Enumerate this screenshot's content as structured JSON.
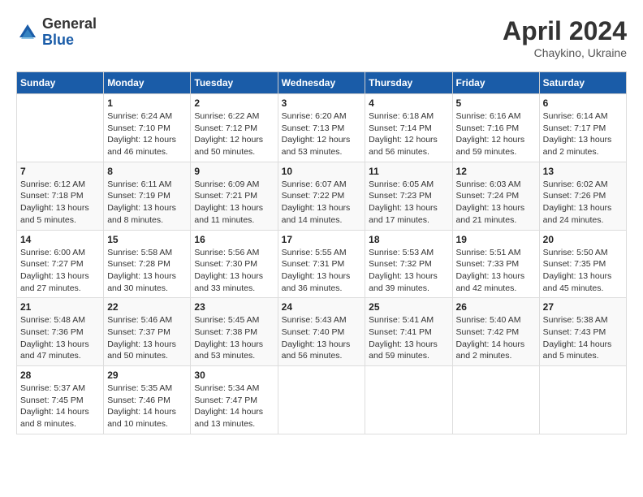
{
  "header": {
    "logo_line1": "General",
    "logo_line2": "Blue",
    "month_title": "April 2024",
    "subtitle": "Chaykino, Ukraine"
  },
  "weekdays": [
    "Sunday",
    "Monday",
    "Tuesday",
    "Wednesday",
    "Thursday",
    "Friday",
    "Saturday"
  ],
  "weeks": [
    [
      {
        "day": "",
        "info": ""
      },
      {
        "day": "1",
        "info": "Sunrise: 6:24 AM\nSunset: 7:10 PM\nDaylight: 12 hours\nand 46 minutes."
      },
      {
        "day": "2",
        "info": "Sunrise: 6:22 AM\nSunset: 7:12 PM\nDaylight: 12 hours\nand 50 minutes."
      },
      {
        "day": "3",
        "info": "Sunrise: 6:20 AM\nSunset: 7:13 PM\nDaylight: 12 hours\nand 53 minutes."
      },
      {
        "day": "4",
        "info": "Sunrise: 6:18 AM\nSunset: 7:14 PM\nDaylight: 12 hours\nand 56 minutes."
      },
      {
        "day": "5",
        "info": "Sunrise: 6:16 AM\nSunset: 7:16 PM\nDaylight: 12 hours\nand 59 minutes."
      },
      {
        "day": "6",
        "info": "Sunrise: 6:14 AM\nSunset: 7:17 PM\nDaylight: 13 hours\nand 2 minutes."
      }
    ],
    [
      {
        "day": "7",
        "info": "Sunrise: 6:12 AM\nSunset: 7:18 PM\nDaylight: 13 hours\nand 5 minutes."
      },
      {
        "day": "8",
        "info": "Sunrise: 6:11 AM\nSunset: 7:19 PM\nDaylight: 13 hours\nand 8 minutes."
      },
      {
        "day": "9",
        "info": "Sunrise: 6:09 AM\nSunset: 7:21 PM\nDaylight: 13 hours\nand 11 minutes."
      },
      {
        "day": "10",
        "info": "Sunrise: 6:07 AM\nSunset: 7:22 PM\nDaylight: 13 hours\nand 14 minutes."
      },
      {
        "day": "11",
        "info": "Sunrise: 6:05 AM\nSunset: 7:23 PM\nDaylight: 13 hours\nand 17 minutes."
      },
      {
        "day": "12",
        "info": "Sunrise: 6:03 AM\nSunset: 7:24 PM\nDaylight: 13 hours\nand 21 minutes."
      },
      {
        "day": "13",
        "info": "Sunrise: 6:02 AM\nSunset: 7:26 PM\nDaylight: 13 hours\nand 24 minutes."
      }
    ],
    [
      {
        "day": "14",
        "info": "Sunrise: 6:00 AM\nSunset: 7:27 PM\nDaylight: 13 hours\nand 27 minutes."
      },
      {
        "day": "15",
        "info": "Sunrise: 5:58 AM\nSunset: 7:28 PM\nDaylight: 13 hours\nand 30 minutes."
      },
      {
        "day": "16",
        "info": "Sunrise: 5:56 AM\nSunset: 7:30 PM\nDaylight: 13 hours\nand 33 minutes."
      },
      {
        "day": "17",
        "info": "Sunrise: 5:55 AM\nSunset: 7:31 PM\nDaylight: 13 hours\nand 36 minutes."
      },
      {
        "day": "18",
        "info": "Sunrise: 5:53 AM\nSunset: 7:32 PM\nDaylight: 13 hours\nand 39 minutes."
      },
      {
        "day": "19",
        "info": "Sunrise: 5:51 AM\nSunset: 7:33 PM\nDaylight: 13 hours\nand 42 minutes."
      },
      {
        "day": "20",
        "info": "Sunrise: 5:50 AM\nSunset: 7:35 PM\nDaylight: 13 hours\nand 45 minutes."
      }
    ],
    [
      {
        "day": "21",
        "info": "Sunrise: 5:48 AM\nSunset: 7:36 PM\nDaylight: 13 hours\nand 47 minutes."
      },
      {
        "day": "22",
        "info": "Sunrise: 5:46 AM\nSunset: 7:37 PM\nDaylight: 13 hours\nand 50 minutes."
      },
      {
        "day": "23",
        "info": "Sunrise: 5:45 AM\nSunset: 7:38 PM\nDaylight: 13 hours\nand 53 minutes."
      },
      {
        "day": "24",
        "info": "Sunrise: 5:43 AM\nSunset: 7:40 PM\nDaylight: 13 hours\nand 56 minutes."
      },
      {
        "day": "25",
        "info": "Sunrise: 5:41 AM\nSunset: 7:41 PM\nDaylight: 13 hours\nand 59 minutes."
      },
      {
        "day": "26",
        "info": "Sunrise: 5:40 AM\nSunset: 7:42 PM\nDaylight: 14 hours\nand 2 minutes."
      },
      {
        "day": "27",
        "info": "Sunrise: 5:38 AM\nSunset: 7:43 PM\nDaylight: 14 hours\nand 5 minutes."
      }
    ],
    [
      {
        "day": "28",
        "info": "Sunrise: 5:37 AM\nSunset: 7:45 PM\nDaylight: 14 hours\nand 8 minutes."
      },
      {
        "day": "29",
        "info": "Sunrise: 5:35 AM\nSunset: 7:46 PM\nDaylight: 14 hours\nand 10 minutes."
      },
      {
        "day": "30",
        "info": "Sunrise: 5:34 AM\nSunset: 7:47 PM\nDaylight: 14 hours\nand 13 minutes."
      },
      {
        "day": "",
        "info": ""
      },
      {
        "day": "",
        "info": ""
      },
      {
        "day": "",
        "info": ""
      },
      {
        "day": "",
        "info": ""
      }
    ]
  ]
}
